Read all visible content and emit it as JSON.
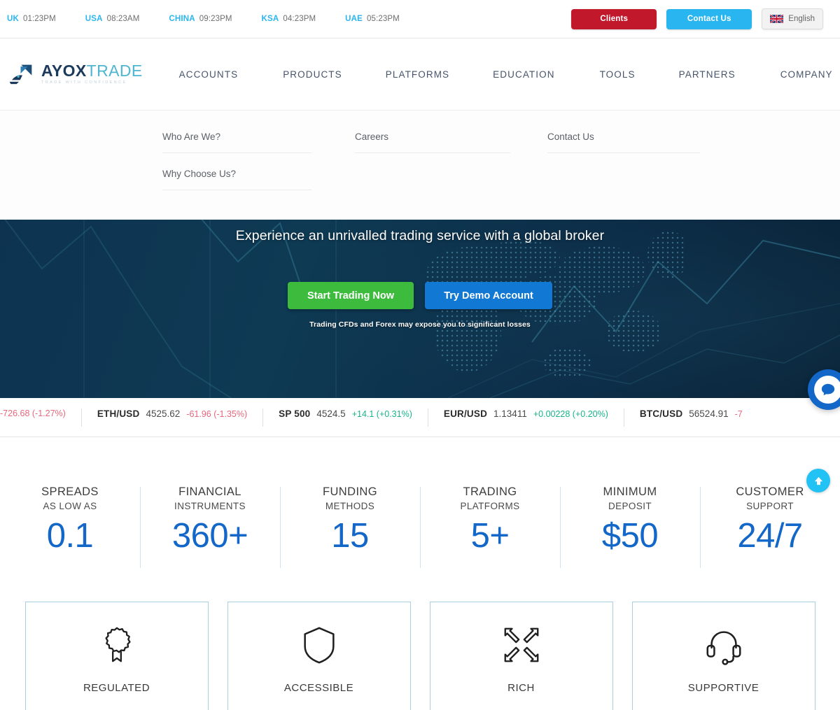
{
  "topbar": {
    "clocks": [
      {
        "city": "UK",
        "time": "01:23PM"
      },
      {
        "city": "USA",
        "time": "08:23AM"
      },
      {
        "city": "CHINA",
        "time": "09:23PM"
      },
      {
        "city": "KSA",
        "time": "04:23PM"
      },
      {
        "city": "UAE",
        "time": "05:23PM"
      }
    ],
    "clients_label": "Clients",
    "contact_label": "Contact Us",
    "language": "English",
    "flag_icon": "uk-flag-icon",
    "clients_color": "#c2182b",
    "contact_color": "#29b6f0",
    "city_color": "#29b6f0"
  },
  "logo": {
    "part1": "AYOX",
    "part2": "TRADE",
    "tagline": "TRADE WITH CONFIDENCE",
    "mark_icon": "ayox-logo-mark-icon",
    "color1": "#1b3a5c",
    "color2": "#4fb6cf"
  },
  "nav": {
    "items": [
      {
        "label": "ACCOUNTS"
      },
      {
        "label": "PRODUCTS"
      },
      {
        "label": "PLATFORMS"
      },
      {
        "label": "EDUCATION"
      },
      {
        "label": "TOOLS"
      },
      {
        "label": "PARTNERS"
      },
      {
        "label": "COMPANY"
      }
    ]
  },
  "dropdown": {
    "open_for": "COMPANY",
    "columns": [
      {
        "items": [
          {
            "label": "Who Are We?"
          },
          {
            "label": "Why Choose Us?"
          }
        ]
      },
      {
        "items": [
          {
            "label": "Careers"
          }
        ]
      },
      {
        "items": [
          {
            "label": "Contact Us"
          }
        ]
      }
    ]
  },
  "hero": {
    "title": "Experience an unrivalled trading service with a global broker",
    "primary_button": "Start Trading Now",
    "secondary_button": "Try Demo Account",
    "disclaimer": "Trading CFDs and Forex may expose you to significant losses",
    "primary_color": "#3dbb3d",
    "secondary_color": "#1179d4",
    "background_color": "#0d3350"
  },
  "ticker": {
    "items": [
      {
        "symbol": "",
        "price": "",
        "change": "-726.68 (-1.27%)",
        "direction": "down",
        "truncated_left": true
      },
      {
        "symbol": "ETH/USD",
        "price": "4525.62",
        "change": "-61.96 (-1.35%)",
        "direction": "down"
      },
      {
        "symbol": "SP 500",
        "price": "4524.5",
        "change": "+14.1 (+0.31%)",
        "direction": "up"
      },
      {
        "symbol": "EUR/USD",
        "price": "1.13411",
        "change": "+0.00228 (+0.20%)",
        "direction": "up"
      },
      {
        "symbol": "BTC/USD",
        "price": "56524.91",
        "change": "-7",
        "direction": "down",
        "truncated_right": true
      }
    ],
    "up_color": "#18b48a",
    "down_color": "#e8677c"
  },
  "stats": {
    "accent_color": "#1267c8",
    "items": [
      {
        "line1": "SPREADS",
        "line2": "AS LOW AS",
        "value": "0.1"
      },
      {
        "line1": "FINANCIAL",
        "line2": "INSTRUMENTS",
        "value": "360+"
      },
      {
        "line1": "FUNDING",
        "line2": "METHODS",
        "value": "15"
      },
      {
        "line1": "TRADING",
        "line2": "PLATFORMS",
        "value": "5+"
      },
      {
        "line1": "MINIMUM",
        "line2": "DEPOSIT",
        "value": "$50"
      },
      {
        "line1": "CUSTOMER",
        "line2": "SUPPORT",
        "value": "24/7"
      }
    ]
  },
  "features": {
    "cards": [
      {
        "label": "REGULATED",
        "icon": "award-badge-icon"
      },
      {
        "label": "ACCESSIBLE",
        "icon": "shield-icon"
      },
      {
        "label": "RICH",
        "icon": "compress-arrows-icon"
      },
      {
        "label": "SUPPORTIVE",
        "icon": "headset-icon"
      }
    ],
    "border_color": "#a9cfe2"
  },
  "widgets": {
    "chat_icon": "chat-bubble-icon",
    "scroll_top_icon": "arrow-up-icon",
    "scroll_top_color": "#22c2f5"
  }
}
